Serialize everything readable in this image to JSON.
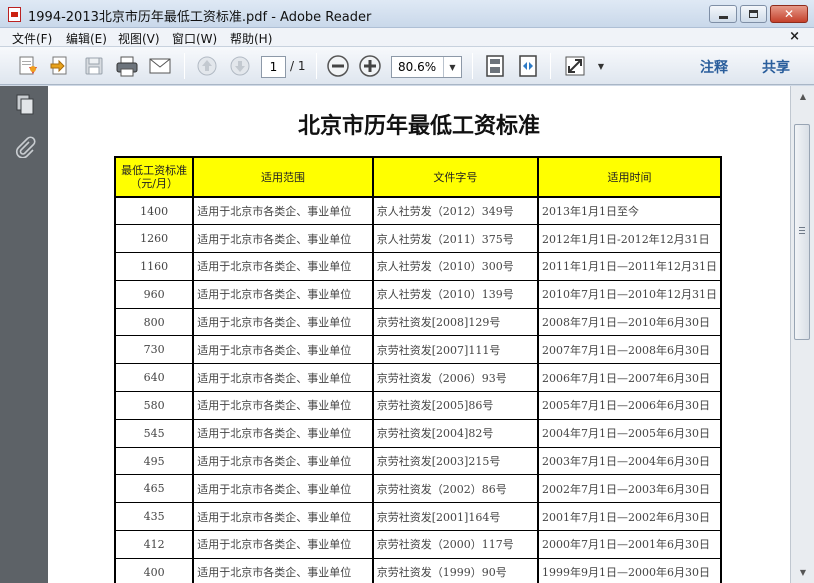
{
  "window": {
    "title": "1994-2013北京市历年最低工资标准.pdf - Adobe Reader"
  },
  "menu": {
    "items": [
      "文件(F)",
      "编辑(E)",
      "视图(V)",
      "窗口(W)",
      "帮助(H)"
    ],
    "close_glyph": "×"
  },
  "toolbar": {
    "page_current": "1",
    "page_total": "/ 1",
    "zoom": "80.6%",
    "comment_label": "注释",
    "share_label": "共享"
  },
  "document": {
    "title": "北京市历年最低工资标准",
    "table": {
      "headers": [
        "最低工资标准（元/月）",
        "适用范围",
        "文件字号",
        "适用时间"
      ],
      "rows": [
        [
          "1400",
          "适用于北京市各类企、事业单位",
          "京人社劳发（2012）349号",
          "2013年1月1日至今"
        ],
        [
          "1260",
          "适用于北京市各类企、事业单位",
          "京人社劳发（2011）375号",
          "2012年1月1日-2012年12月31日"
        ],
        [
          "1160",
          "适用于北京市各类企、事业单位",
          "京人社劳发（2010）300号",
          "2011年1月1日—2011年12月31日"
        ],
        [
          "960",
          "适用于北京市各类企、事业单位",
          "京人社劳发（2010）139号",
          "2010年7月1日—2010年12月31日"
        ],
        [
          "800",
          "适用于北京市各类企、事业单位",
          "京劳社资发[2008]129号",
          "2008年7月1日—2010年6月30日"
        ],
        [
          "730",
          "适用于北京市各类企、事业单位",
          "京劳社资发[2007]111号",
          "2007年7月1日—2008年6月30日"
        ],
        [
          "640",
          "适用于北京市各类企、事业单位",
          "京劳社资发（2006）93号",
          "2006年7月1日—2007年6月30日"
        ],
        [
          "580",
          "适用于北京市各类企、事业单位",
          "京劳社资发[2005]86号",
          "2005年7月1日—2006年6月30日"
        ],
        [
          "545",
          "适用于北京市各类企、事业单位",
          "京劳社资发[2004]82号",
          "2004年7月1日—2005年6月30日"
        ],
        [
          "495",
          "适用于北京市各类企、事业单位",
          "京劳社资发[2003]215号",
          "2003年7月1日—2004年6月30日"
        ],
        [
          "465",
          "适用于北京市各类企、事业单位",
          "京劳社资发（2002）86号",
          "2002年7月1日—2003年6月30日"
        ],
        [
          "435",
          "适用于北京市各类企、事业单位",
          "京劳社资发[2001]164号",
          "2001年7月1日—2002年6月30日"
        ],
        [
          "412",
          "适用于北京市各类企、事业单位",
          "京劳社资发（2000）117号",
          "2000年7月1日—2001年6月30日"
        ],
        [
          "400",
          "适用于北京市各类企、事业单位",
          "京劳社资发（1999）90号",
          "1999年9月1日—2000年6月30日"
        ]
      ]
    }
  },
  "colors": {
    "header_bg": "#ffff00",
    "nav_panel": "#5d6267",
    "accent_text": "#2a5e9c"
  }
}
